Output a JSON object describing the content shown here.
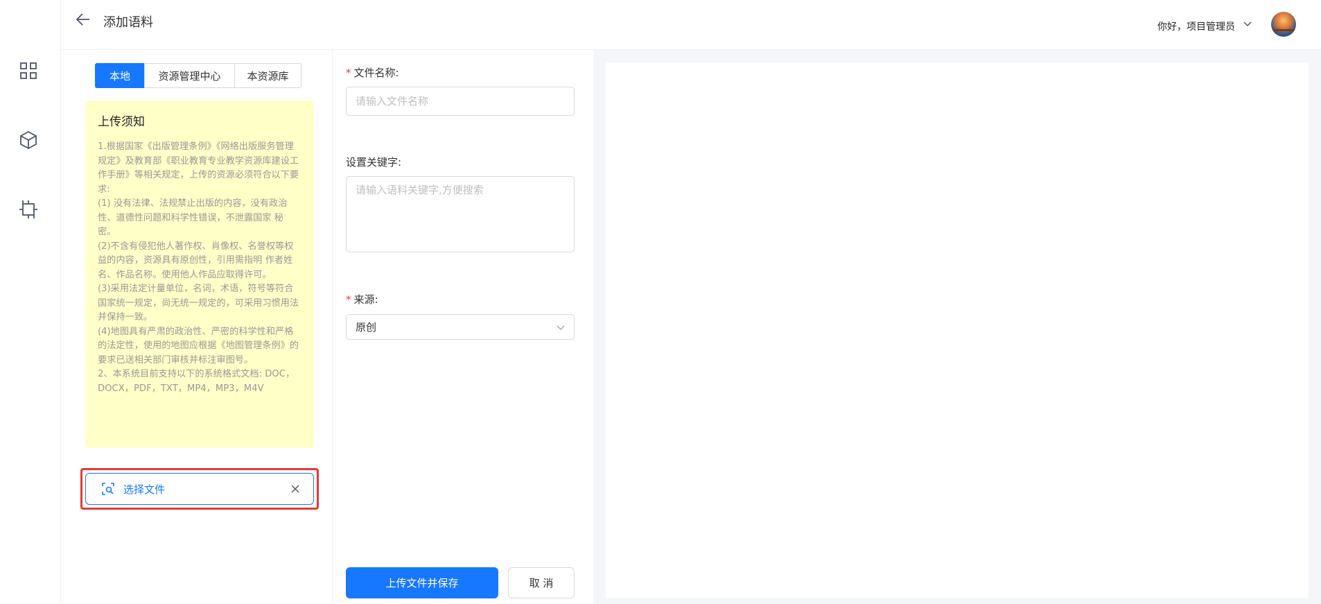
{
  "header": {
    "title": "添加语料",
    "greeting": "你好，项目管理员"
  },
  "sidebar": {
    "items": [
      {
        "icon": "grid-icon"
      },
      {
        "icon": "cube-icon"
      },
      {
        "icon": "chip-icon"
      }
    ]
  },
  "source_tabs": {
    "active": 0,
    "items": [
      {
        "label": "本地"
      },
      {
        "label": "资源管理中心"
      },
      {
        "label": "本资源库"
      }
    ]
  },
  "notice": {
    "title": "上传须知",
    "body": "1.根据国家《出版管理条例》《网络出版服务管理规定》及教育部《职业教育专业教学资源库建设工作手册》等相关规定，上传的资源必须符合以下要求:\n(1) 没有法律、法规禁止出版的内容，没有政治性、道德性问题和科学性错误，不泄露国家 秘密。\n(2)不含有侵犯他人著作权、肖像权、名誉权等权益的内容，资源具有原创性，引用需指明 作者姓名、作品名称。使用他人作品应取得许可。\n(3)采用法定计量单位，名词，术语，符号等符合国家统一规定，尚无统一规定的，可采用习惯用法并保持一致。\n(4)地图具有严肃的政治性、严密的科学性和严格的法定性，使用的地图应根据《地图管理条例》的要求已送相关部门审核并标注审图号。\n2、本系统目前支持以下的系统格式文档: DOC，DOCX，PDF，TXT，MP4，MP3，M4V"
  },
  "file_select": {
    "label": "选择文件"
  },
  "form": {
    "required_mark": "*",
    "file_name": {
      "label": "文件名称:",
      "value": "",
      "placeholder": "请输入文件名称"
    },
    "keywords": {
      "label": "设置关键字:",
      "value": "",
      "placeholder": "请输入语料关键字,方便搜索"
    },
    "source": {
      "label": "来源:",
      "selected": "原创"
    },
    "submit_label": "上传文件并保存",
    "cancel_label": "取 消"
  },
  "colors": {
    "primary": "#1677ff",
    "notice_bg": "#ffffc8",
    "highlight": "#e53935"
  }
}
